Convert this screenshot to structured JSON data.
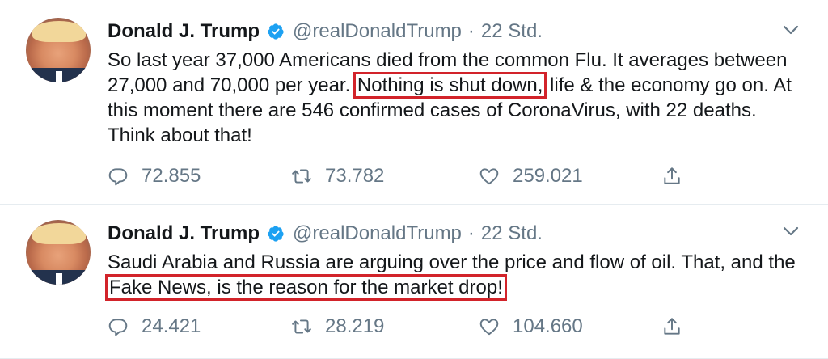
{
  "colors": {
    "text": "#14171a",
    "secondary": "#657786",
    "verified": "#1da1f2",
    "highlight_box": "#d2232a",
    "divider": "#e6ecf0"
  },
  "icons": {
    "reply": "speech-bubble-icon",
    "retweet": "retweet-icon",
    "like": "heart-icon",
    "share": "share-icon",
    "menu": "chevron-down-icon",
    "verified": "verified-badge-icon"
  },
  "tweets": [
    {
      "name": "Donald J. Trump",
      "handle": "@realDonaldTrump",
      "separator": "·",
      "time": "22 Std.",
      "text_parts": [
        "So last year 37,000 Americans died from the common Flu. It averages between 27,000 and 70,000 per year. ",
        "Nothing is shut down,",
        " life & the economy go on. At this moment there are 546 confirmed cases of CoronaVirus, with 22 deaths. Think about that!"
      ],
      "replies": "72.855",
      "retweets": "73.782",
      "likes": "259.021"
    },
    {
      "name": "Donald J. Trump",
      "handle": "@realDonaldTrump",
      "separator": "·",
      "time": "22 Std.",
      "text_parts": [
        "Saudi Arabia and Russia are arguing over the price and flow of oil. That, and the ",
        "Fake News, is the reason for the market drop!",
        ""
      ],
      "replies": "24.421",
      "retweets": "28.219",
      "likes": "104.660"
    }
  ]
}
